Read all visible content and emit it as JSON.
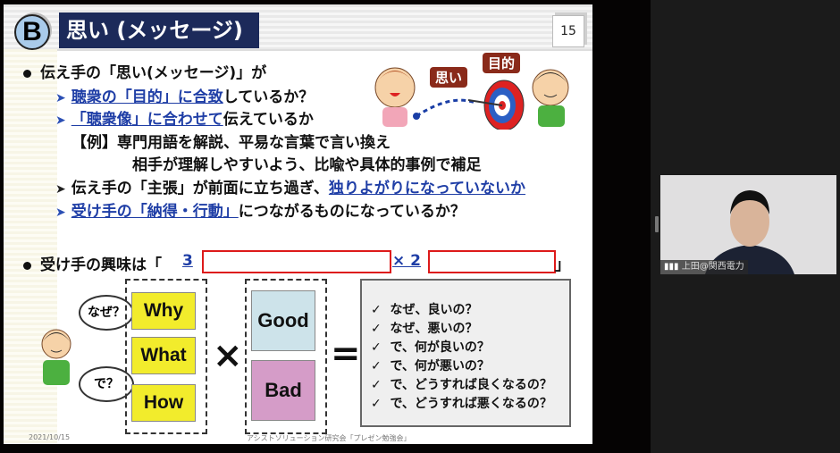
{
  "slide": {
    "badge": "B",
    "title": "思い (メッセージ)",
    "page_number": "15",
    "bullet1": "伝え手の「思い(メッセージ)」が",
    "sub1_hl": "聴衆の「目的」に合致",
    "sub1_rest": "しているか？",
    "sub2_hl": "「聴衆像」に合わせて",
    "sub2_rest": "伝えているか",
    "example_line1": "【例】専門用語を解説、平易な言葉で言い換え",
    "example_line2": "相手が理解しやすいよう、比喩や具体的事例で補足",
    "sub3_pre": "伝え手の「主張」が前面に立ち過ぎ、",
    "sub3_hl": "独りよがりになっていないか",
    "sub4_hl": "受け手の「納得・行動」",
    "sub4_rest": "につながるものになっているか？",
    "bullet2_pre": "受け手の興味は「",
    "bullet2_num1": "3",
    "bullet2_mid": "× 2",
    "bullet2_end": "」",
    "illustration_tags": {
      "thought": "思い",
      "goal": "目的"
    },
    "bubbles": {
      "why": "なぜ？",
      "so": "で？"
    },
    "tiles_left": [
      "Why",
      "What",
      "How"
    ],
    "tiles_right": [
      "Good",
      "Bad"
    ],
    "operators": {
      "times": "×",
      "equals": "="
    },
    "check_mark": "✓",
    "results": [
      "なぜ、良いの？",
      "なぜ、悪いの？",
      "で、何が良いの？",
      "で、何が悪いの？",
      "で、どうすれば良くなるの？",
      "で、どうすれば悪くなるの？"
    ],
    "footer_date": "2021/10/15",
    "footer_org": "アシストソリューション研究会「プレゼン勉強会」"
  },
  "video": {
    "participant_name": "上田@関西電力"
  },
  "colors": {
    "title_bg": "#1c2a5a",
    "highlight": "#1f3ea6",
    "answer_box": "#dd1a1a",
    "tile_yellow": "#f2ec2c",
    "tile_blue": "#cde3ea",
    "tile_pink": "#d59cc8"
  }
}
